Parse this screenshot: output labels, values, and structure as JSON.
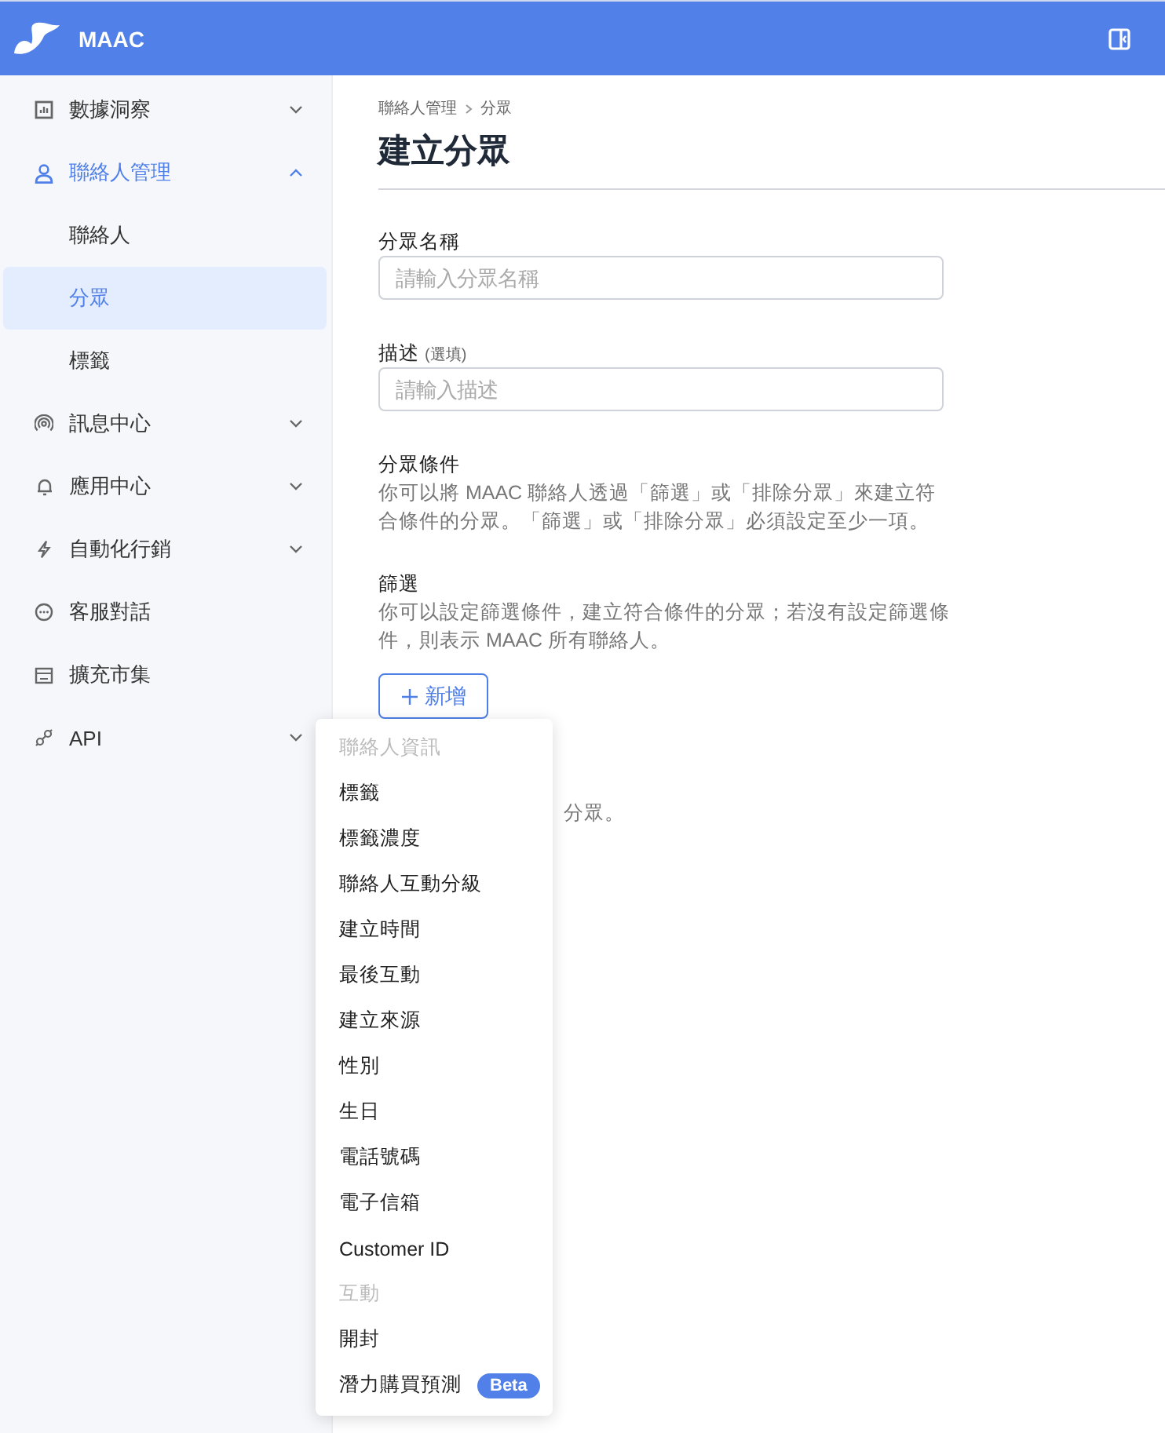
{
  "header": {
    "brand": "MAAC"
  },
  "sidebar": {
    "items": [
      {
        "label": "數據洞察",
        "expanded": false
      },
      {
        "label": "聯絡人管理",
        "expanded": true,
        "children": [
          {
            "label": "聯絡人",
            "selected": false
          },
          {
            "label": "分眾",
            "selected": true
          },
          {
            "label": "標籤",
            "selected": false
          }
        ]
      },
      {
        "label": "訊息中心",
        "expanded": false
      },
      {
        "label": "應用中心",
        "expanded": false
      },
      {
        "label": "自動化行銷",
        "expanded": false
      },
      {
        "label": "客服對話"
      },
      {
        "label": "擴充市集"
      },
      {
        "label": "API",
        "expanded": false
      }
    ]
  },
  "page": {
    "breadcrumb": [
      "聯絡人管理",
      "分眾"
    ],
    "title": "建立分眾",
    "fields": [
      {
        "label": "分眾名稱",
        "placeholder": "請輸入分眾名稱"
      },
      {
        "label": "描述",
        "hint": "(選填)",
        "placeholder": "請輸入描述"
      }
    ],
    "sections": [
      {
        "title": "分眾條件",
        "text": "你可以將 MAAC 聯絡人透過「篩選」或「排除分眾」來建立符合條件的分眾。「篩選」或「排除分眾」必須設定至少一項。"
      },
      {
        "title": "篩選",
        "text": "你可以設定篩選條件，建立符合條件的分眾；若沒有設定篩選條件，則表示 MAAC 所有聯絡人。",
        "button": "新增"
      }
    ],
    "partial_text": "分眾。"
  },
  "menu": {
    "items": [
      {
        "kind": "header",
        "label": "聯絡人資訊"
      },
      {
        "kind": "option",
        "label": "標籤"
      },
      {
        "kind": "option",
        "label": "標籤濃度"
      },
      {
        "kind": "option",
        "label": "聯絡人互動分級"
      },
      {
        "kind": "option",
        "label": "建立時間"
      },
      {
        "kind": "option",
        "label": "最後互動"
      },
      {
        "kind": "option",
        "label": "建立來源"
      },
      {
        "kind": "option",
        "label": "性別"
      },
      {
        "kind": "option",
        "label": "生日"
      },
      {
        "kind": "option",
        "label": "電話號碼"
      },
      {
        "kind": "option",
        "label": "電子信箱"
      },
      {
        "kind": "option",
        "label": "Customer ID"
      },
      {
        "kind": "header",
        "label": "互動"
      },
      {
        "kind": "option",
        "label": "開封"
      },
      {
        "kind": "option",
        "label": "潛力購買預測",
        "badge": "Beta"
      }
    ]
  }
}
